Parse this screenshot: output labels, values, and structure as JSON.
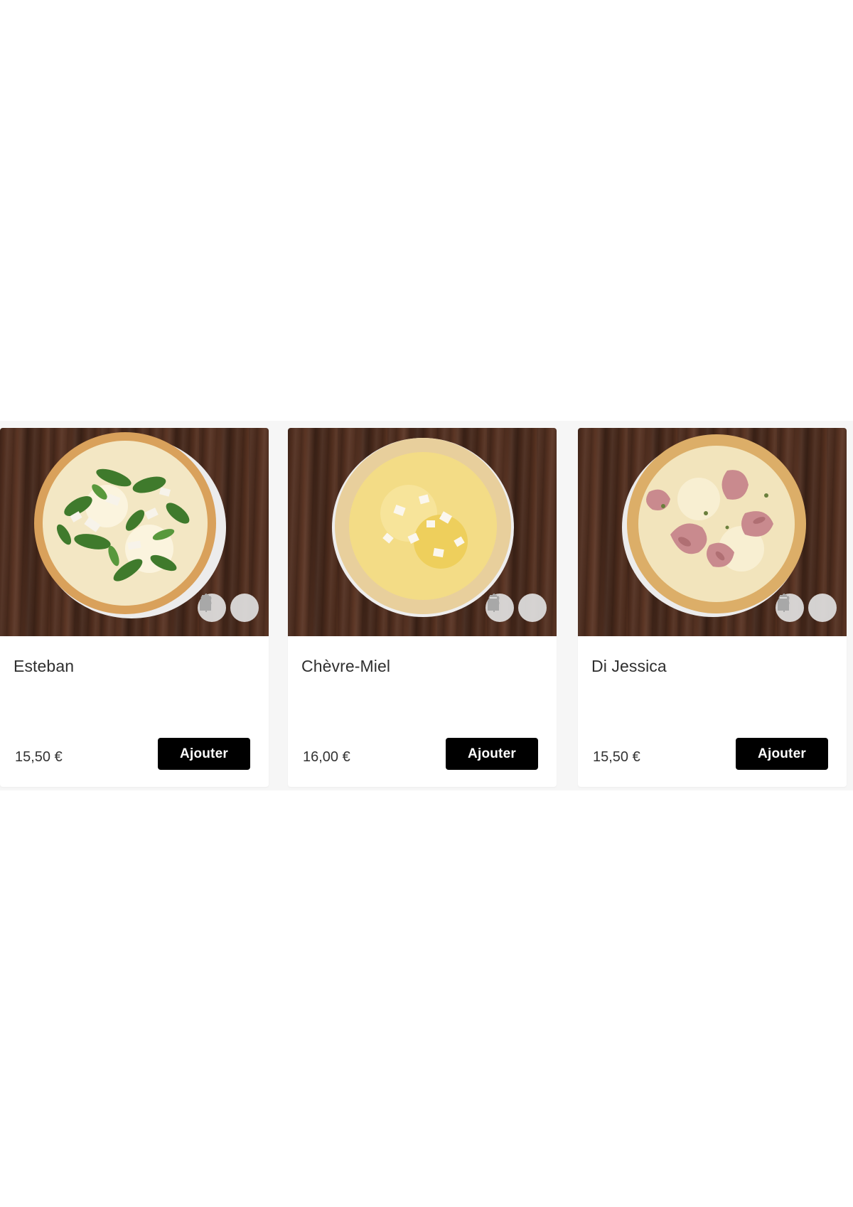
{
  "products": [
    {
      "name": "Esteban",
      "price": "15,50 €",
      "button": "Ajouter",
      "badges": [
        "milk-icon",
        "wheat-icon"
      ]
    },
    {
      "name": "Chèvre-Miel",
      "price": "16,00 €",
      "button": "Ajouter",
      "badges": [
        "wheat-icon",
        "milk-icon"
      ]
    },
    {
      "name": "Di Jessica",
      "price": "15,50 €",
      "button": "Ajouter",
      "badges": [
        "wheat-icon",
        "milk-icon"
      ]
    }
  ],
  "colors": {
    "button_bg": "#000000",
    "button_text": "#ffffff",
    "text": "#2f2f2f",
    "table_wood": "#4a2a1c"
  }
}
